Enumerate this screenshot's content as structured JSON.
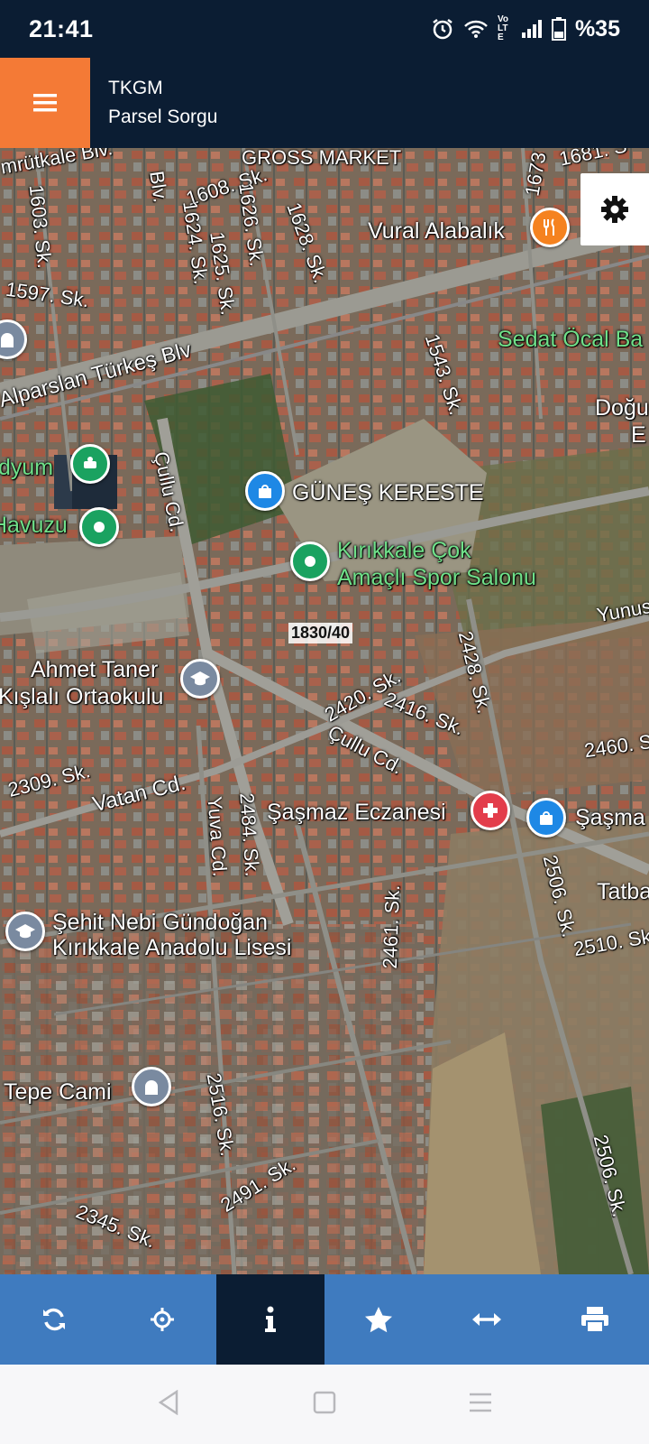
{
  "status": {
    "time": "21:41",
    "battery": "%35",
    "volte": "Vo LTE"
  },
  "app": {
    "title": "TKGM",
    "subtitle": "Parsel Sorgu",
    "colors": {
      "header": "#0b1d33",
      "menu_accent": "#f47a36",
      "toolbar": "#3f7bbf",
      "toolbar_active": "#0b1d33"
    }
  },
  "map": {
    "parcel_label": "1830/40",
    "streets": {
      "s1": "mrütkale Blv.",
      "s2": "Blv.",
      "s3": "1608. Sk.",
      "s4": "1603. Sk.",
      "s5": "1624. Sk.",
      "s6": "1626. Sk.",
      "s7": "1628. Sk.",
      "s8": "1625. Sk.",
      "s9": "1597. Sk.",
      "s10": "1673",
      "s11": "1681. S",
      "s12": "Alparslan Türkeş Blv",
      "s13": "1543. Sk.",
      "s14": "Çullu Cd.",
      "s15": "Yunus",
      "s16": "2428. Sk.",
      "s17": "2420. Sk.",
      "s18": "2416. Sk.",
      "s19": "Çullu Cd.",
      "s20": "2460. S",
      "s21": "2309. Sk.",
      "s22": "Vatan Cd.",
      "s23": "Yuva Cd.",
      "s24": "2484. Sk.",
      "s25": "2461. Sk.",
      "s26": "2506. Sk.",
      "s27": "2510. Sk",
      "s28": "2516. Sk.",
      "s29": "2491. Sk.",
      "s30": "2345. Sk.",
      "s31": "2506. Sk.",
      "s32": "GROSS MARKET"
    },
    "places": {
      "vural": "Vural Alabalık",
      "sedat": "Sedat Öcal Ba",
      "dogu1": "Doğu",
      "dogu2": "E",
      "stadyum": "dyum",
      "havuzu": "Havuzu",
      "gunes": "GÜNEŞ KERESTE",
      "spor1": "Kırıkkale Çok",
      "spor2": "Amaçlı Spor Salonu",
      "ahmet1": "Ahmet Taner",
      "ahmet2": "Kışlalı Ortaokulu",
      "sasmaz": "Şaşmaz Eczanesi",
      "sasma2": "Şaşma",
      "tatb": "Tatba",
      "sehit1": "Şehit Nebi Gündoğan",
      "sehit2": "Kırıkkale Anadolu Lisesi",
      "tepe": "Tepe Cami"
    },
    "icons": [
      "restaurant-icon",
      "mosque-icon",
      "park-icon",
      "shopping-bag-icon",
      "school-icon",
      "pharmacy-icon"
    ]
  },
  "toolbar": {
    "buttons": [
      "refresh-icon",
      "locate-icon",
      "info-icon",
      "favorite-icon",
      "measure-icon",
      "print-icon"
    ],
    "active": "info-icon"
  }
}
